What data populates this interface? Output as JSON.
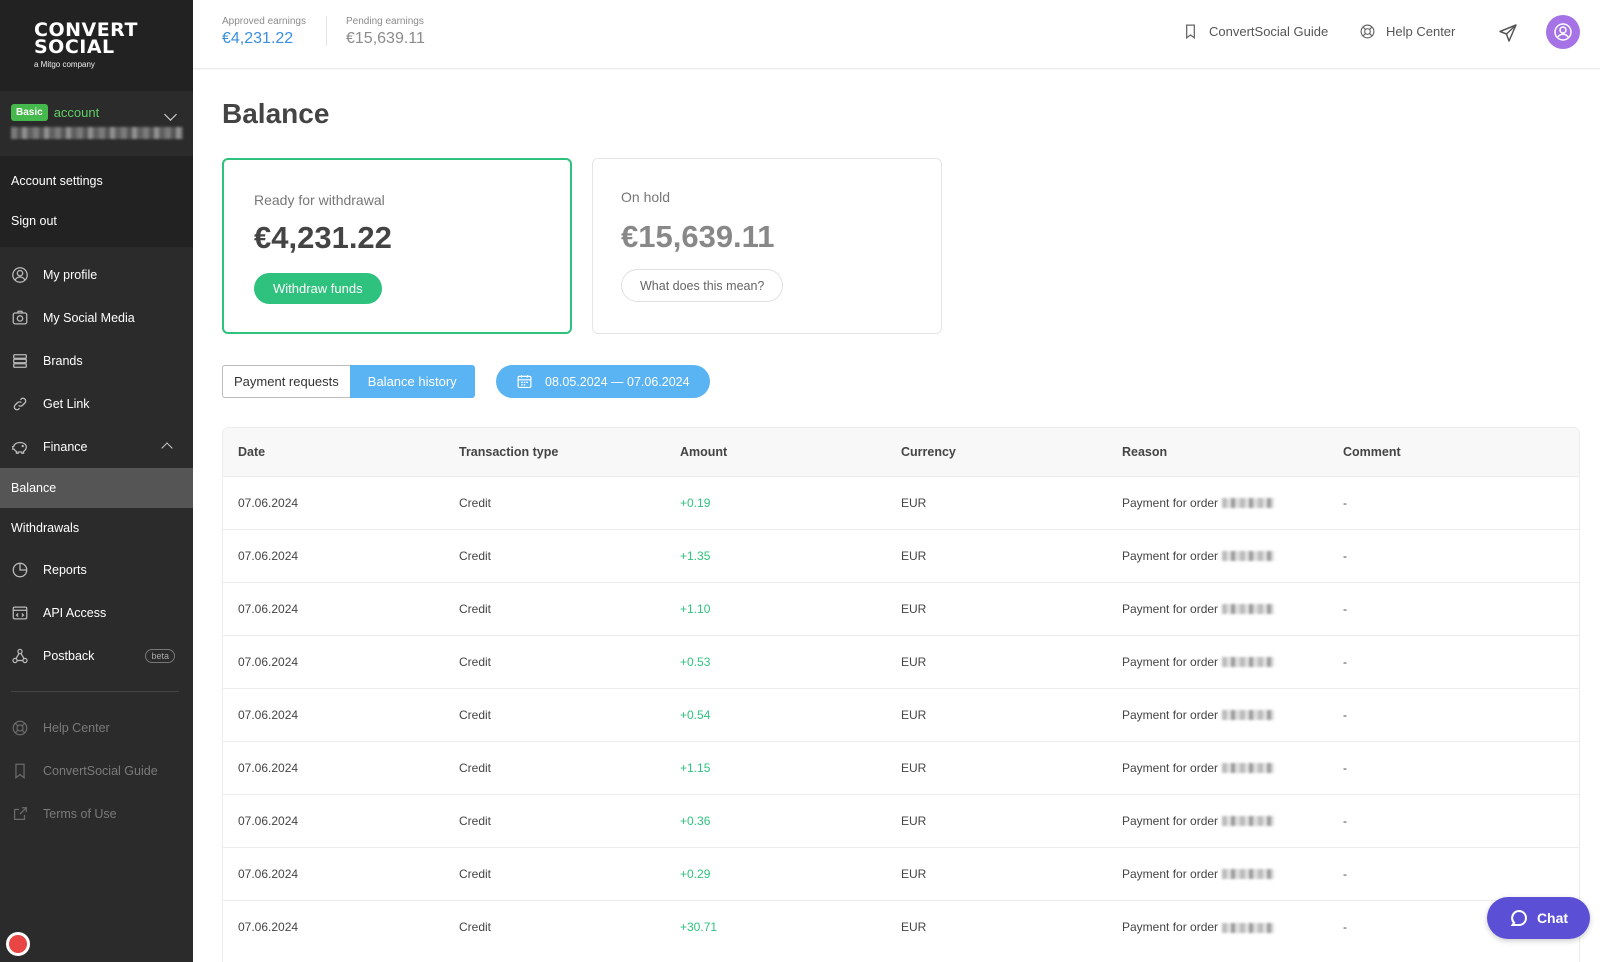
{
  "brand": {
    "line1": "CONVERT",
    "line2": "SOCIAL",
    "tagline": "a Mitgo company"
  },
  "account": {
    "badge": "Basic",
    "label": "account"
  },
  "settings_menu": [
    {
      "label": "Account settings"
    },
    {
      "label": "Sign out"
    }
  ],
  "nav": {
    "my_profile": "My profile",
    "my_social_media": "My Social Media",
    "brands": "Brands",
    "get_link": "Get Link",
    "finance": "Finance",
    "balance": "Balance",
    "withdrawals": "Withdrawals",
    "reports": "Reports",
    "api_access": "API Access",
    "postback": "Postback",
    "postback_badge": "beta",
    "help_center": "Help Center",
    "guide": "ConvertSocial Guide",
    "terms": "Terms of Use"
  },
  "topbar": {
    "approved_label": "Approved earnings",
    "approved_value": "€4,231.22",
    "pending_label": "Pending earnings",
    "pending_value": "€15,639.11",
    "guide_link": "ConvertSocial Guide",
    "help_link": "Help Center"
  },
  "page": {
    "title": "Balance"
  },
  "cards": {
    "ready": {
      "label": "Ready for withdrawal",
      "amount": "€4,231.22",
      "button": "Withdraw funds"
    },
    "hold": {
      "label": "On hold",
      "amount": "€15,639.11",
      "button": "What does this mean?"
    }
  },
  "tabs": {
    "payment_requests": "Payment requests",
    "balance_history": "Balance history"
  },
  "date_range": "08.05.2024 — 07.06.2024",
  "table": {
    "headers": [
      "Date",
      "Transaction type",
      "Amount",
      "Currency",
      "Reason",
      "Comment"
    ],
    "rows": [
      {
        "date": "07.06.2024",
        "type": "Credit",
        "amount": "+0.19",
        "currency": "EUR",
        "reason": "Payment for order",
        "comment": "-"
      },
      {
        "date": "07.06.2024",
        "type": "Credit",
        "amount": "+1.35",
        "currency": "EUR",
        "reason": "Payment for order",
        "comment": "-"
      },
      {
        "date": "07.06.2024",
        "type": "Credit",
        "amount": "+1.10",
        "currency": "EUR",
        "reason": "Payment for order",
        "comment": "-"
      },
      {
        "date": "07.06.2024",
        "type": "Credit",
        "amount": "+0.53",
        "currency": "EUR",
        "reason": "Payment for order",
        "comment": "-"
      },
      {
        "date": "07.06.2024",
        "type": "Credit",
        "amount": "+0.54",
        "currency": "EUR",
        "reason": "Payment for order",
        "comment": "-"
      },
      {
        "date": "07.06.2024",
        "type": "Credit",
        "amount": "+1.15",
        "currency": "EUR",
        "reason": "Payment for order",
        "comment": "-"
      },
      {
        "date": "07.06.2024",
        "type": "Credit",
        "amount": "+0.36",
        "currency": "EUR",
        "reason": "Payment for order",
        "comment": "-"
      },
      {
        "date": "07.06.2024",
        "type": "Credit",
        "amount": "+0.29",
        "currency": "EUR",
        "reason": "Payment for order",
        "comment": "-"
      },
      {
        "date": "07.06.2024",
        "type": "Credit",
        "amount": "+30.71",
        "currency": "EUR",
        "reason": "Payment for order",
        "comment": "-"
      }
    ]
  },
  "chat": {
    "label": "Chat"
  },
  "colors": {
    "accent_green": "#2ec27e",
    "accent_blue": "#5ab3f2",
    "approved_blue": "#3b8ee0",
    "avatar_purple": "#a573e6",
    "chat_purple": "#5b4fd6"
  }
}
